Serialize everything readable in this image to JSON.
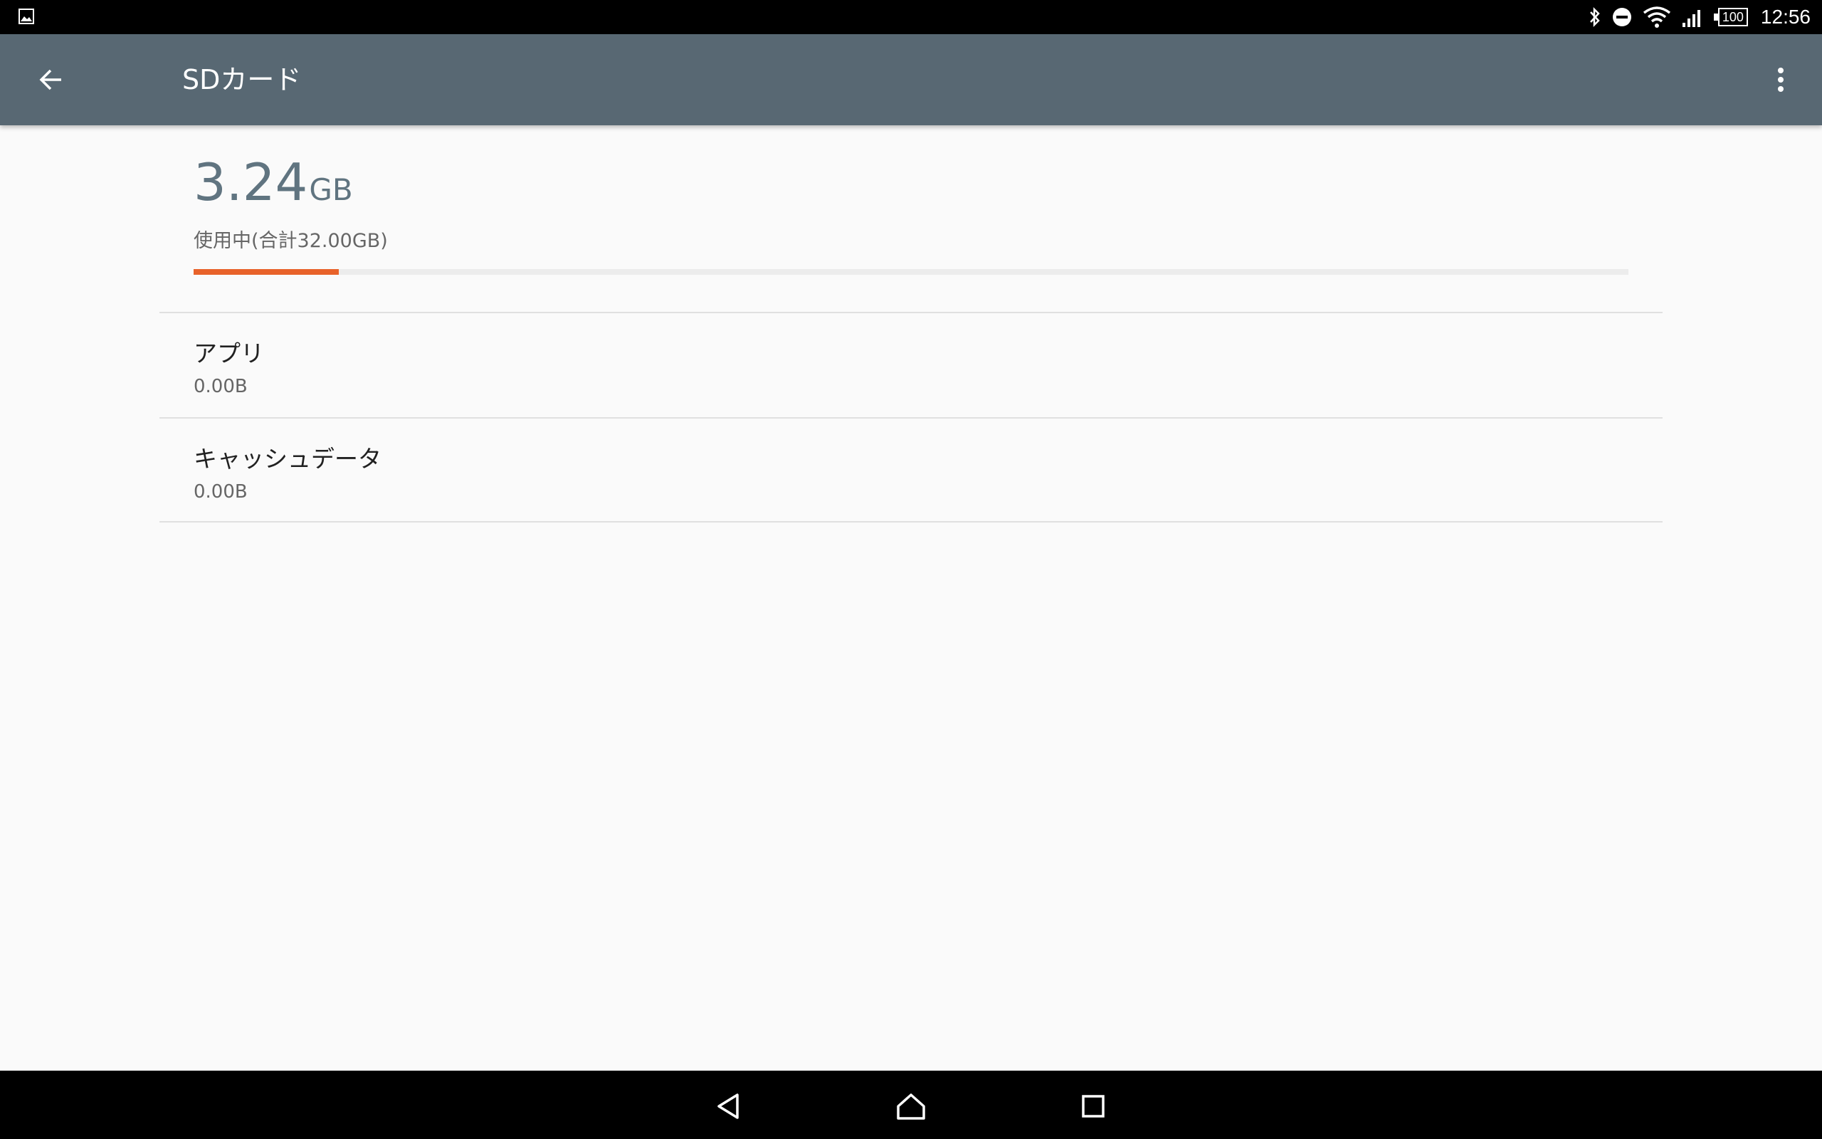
{
  "status_bar": {
    "time": "12:56",
    "battery_level": "100",
    "icons": [
      "image-notification-icon",
      "bluetooth-icon",
      "do-not-disturb-icon",
      "wifi-icon",
      "cellular-signal-icon",
      "battery-icon"
    ]
  },
  "app_bar": {
    "title": "SDカード",
    "back_icon": "arrow-back-icon",
    "menu_icon": "more-vert-icon",
    "color": "#586873"
  },
  "storage": {
    "used_value": "3.24",
    "used_unit": "GB",
    "caption": "使用中(合計32.00GB)",
    "used_fraction": 0.101,
    "bar_color": "#e8622a",
    "value_color": "#607480"
  },
  "items": [
    {
      "title": "アプリ",
      "size": "0.00B"
    },
    {
      "title": "キャッシュデータ",
      "size": "0.00B"
    }
  ],
  "nav_bar": {
    "buttons": [
      "nav-back-icon",
      "nav-home-icon",
      "nav-recents-icon"
    ]
  }
}
